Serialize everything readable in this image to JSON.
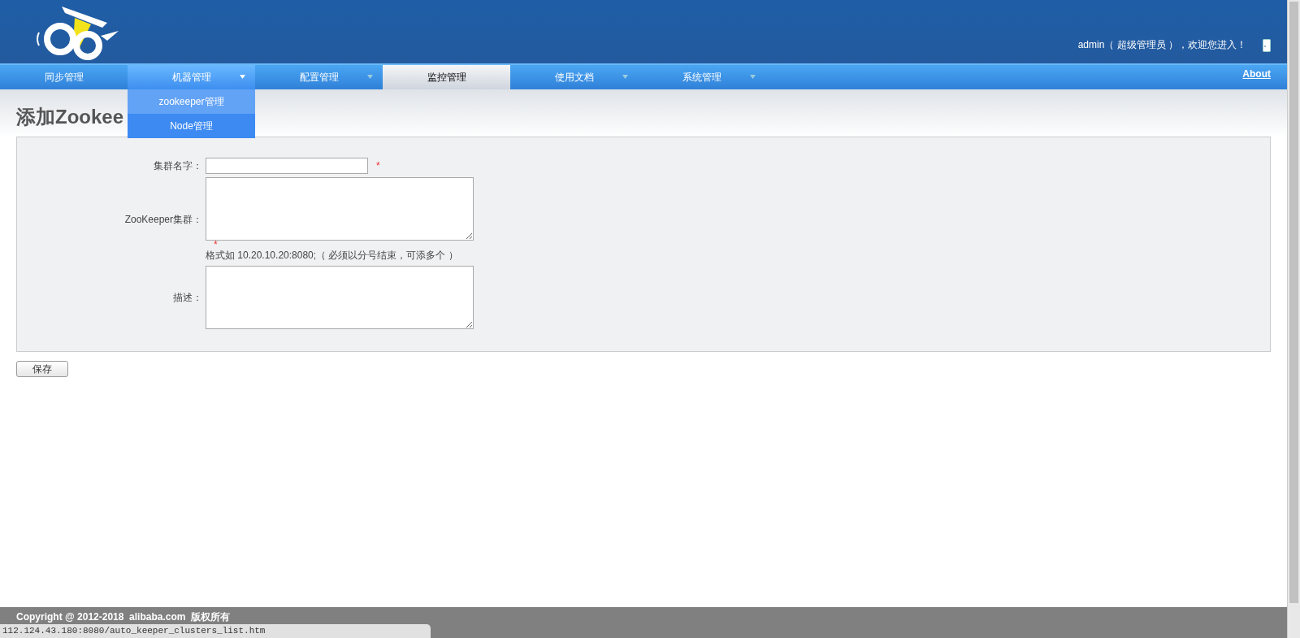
{
  "header": {
    "user": "admin",
    "role": "（ 超级管理员 ）",
    "welcome": "，欢迎您进入！"
  },
  "nav": {
    "items": [
      {
        "label": "同步管理",
        "has_menu": false,
        "selected": false,
        "expanded": false
      },
      {
        "label": "机器管理",
        "has_menu": true,
        "selected": false,
        "expanded": true,
        "menu": [
          {
            "label": "zookeeper管理",
            "hovered": true
          },
          {
            "label": "Node管理",
            "hovered": false
          }
        ]
      },
      {
        "label": "配置管理",
        "has_menu": true,
        "selected": false,
        "expanded": false
      },
      {
        "label": "监控管理",
        "has_menu": false,
        "selected": true,
        "expanded": false
      },
      {
        "label": "使用文档",
        "has_menu": true,
        "selected": false,
        "expanded": false
      },
      {
        "label": "系统管理",
        "has_menu": true,
        "selected": false,
        "expanded": false
      }
    ],
    "about": "About"
  },
  "page_title": "添加Zookee",
  "form": {
    "fields": [
      {
        "label": "集群名字：",
        "kind": "input",
        "required_mark": "*"
      },
      {
        "label": "ZooKeeper集群：",
        "kind": "textarea",
        "required_mark": "*",
        "hint": "格式如 10.20.10.20:8080;（ 必须以分号结束，可添多个 ）"
      },
      {
        "label": "描述：",
        "kind": "textarea"
      }
    ],
    "save": "保存"
  },
  "footer": "Copyright @ 2012-2018  alibaba.com  版权所有",
  "status_url": "112.124.43.180:8080/auto_keeper_clusters_list.htm"
}
